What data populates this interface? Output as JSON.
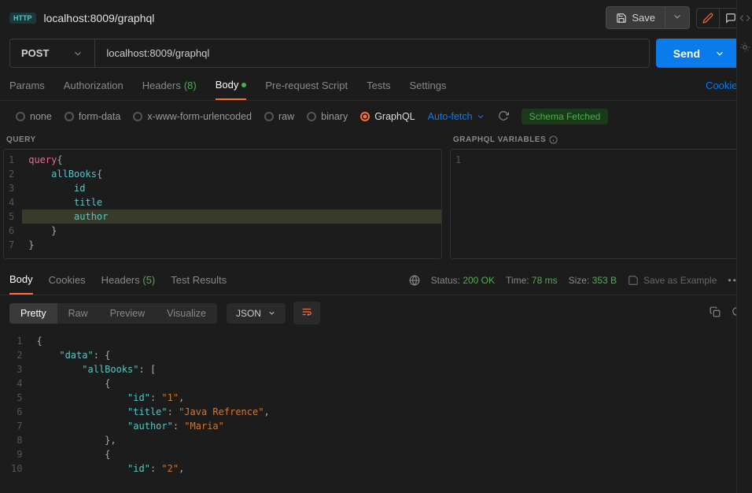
{
  "topbar": {
    "badge": "HTTP",
    "title": "localhost:8009/graphql",
    "save_label": "Save"
  },
  "request": {
    "method": "POST",
    "url": "localhost:8009/graphql",
    "send_label": "Send"
  },
  "tabs": {
    "params": "Params",
    "authorization": "Authorization",
    "headers": "Headers",
    "headers_count": "(8)",
    "body": "Body",
    "prerequest": "Pre-request Script",
    "tests": "Tests",
    "settings": "Settings",
    "cookies": "Cookies"
  },
  "body_types": {
    "none": "none",
    "formdata": "form-data",
    "urlenc": "x-www-form-urlencoded",
    "raw": "raw",
    "binary": "binary",
    "graphql": "GraphQL",
    "autofetch": "Auto-fetch",
    "schema_status": "Schema Fetched"
  },
  "query_panel": {
    "label": "QUERY",
    "vars_label": "GRAPHQL VARIABLES",
    "lines": {
      "l1_kw": "query",
      "l1_brace": "{",
      "l2_field": "allBooks",
      "l2_brace": "{",
      "l3_field": "id",
      "l4_field": "title",
      "l5_field": "author",
      "l6_brace": "}",
      "l7_brace": "}"
    }
  },
  "response": {
    "tabs": {
      "body": "Body",
      "cookies": "Cookies",
      "headers": "Headers",
      "headers_count": "(5)",
      "test_results": "Test Results"
    },
    "meta": {
      "status_label": "Status:",
      "status_value": "200 OK",
      "time_label": "Time:",
      "time_value": "78 ms",
      "size_label": "Size:",
      "size_value": "353 B",
      "save_example": "Save as Example"
    },
    "view": {
      "pretty": "Pretty",
      "raw": "Raw",
      "preview": "Preview",
      "visualize": "Visualize",
      "format": "JSON"
    },
    "body_lines": {
      "l1": "{",
      "l2_key": "\"data\"",
      "l3_key": "\"allBooks\"",
      "l5_id_key": "\"id\"",
      "l5_id_val": "\"1\"",
      "l6_title_key": "\"title\"",
      "l6_title_val": "\"Java Refrence\"",
      "l7_author_key": "\"author\"",
      "l7_author_val": "\"Maria\"",
      "l10_id_key": "\"id\"",
      "l10_id_val": "\"2\""
    }
  }
}
